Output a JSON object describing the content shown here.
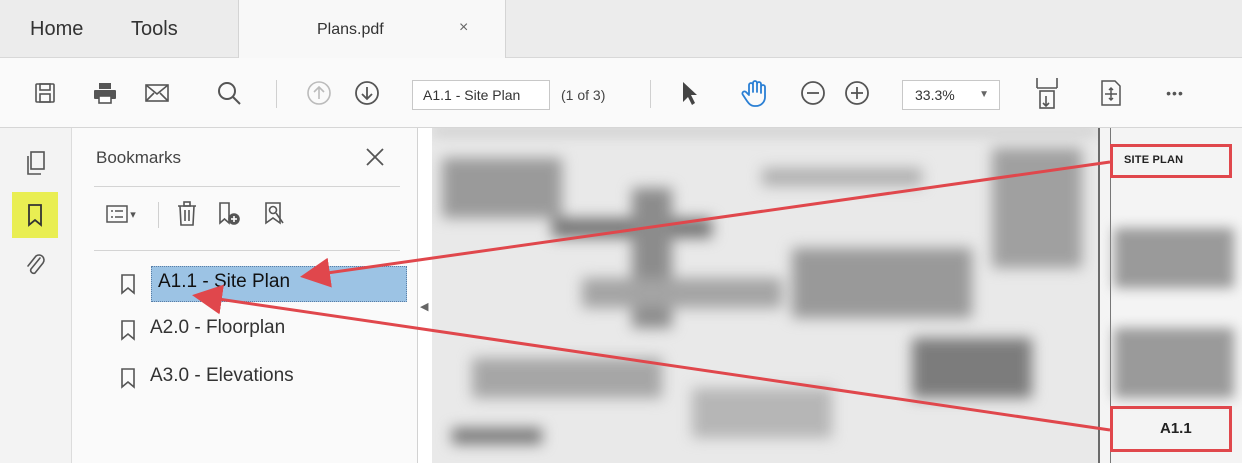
{
  "menubar": {
    "home_label": "Home",
    "tools_label": "Tools",
    "document_tab_title": "Plans.pdf",
    "document_tab_close": "×"
  },
  "toolbar": {
    "icons": [
      "save-icon",
      "print-icon",
      "email-icon",
      "search-icon",
      "previous-page-icon",
      "next-page-icon",
      "select-tool-icon",
      "hand-tool-icon",
      "zoom-out-icon",
      "zoom-in-icon",
      "fit-page-icon",
      "page-display-icon",
      "more-tools-icon"
    ],
    "page_box_value": "A1.1 - Site Plan",
    "page_count": "(1 of 3)",
    "zoom_value": "33.3%",
    "zoom_caret": "▼",
    "more_label": "•••"
  },
  "rail": {
    "icons": [
      "page-thumbnails-icon",
      "bookmarks-icon",
      "attachments-icon"
    ],
    "active_color": "#e9ee52"
  },
  "bookmarks_panel": {
    "title": "Bookmarks",
    "tools": [
      "options-icon",
      "delete-bookmark-icon",
      "new-bookmark-icon",
      "bookmark-search-icon"
    ],
    "options_caret": "▾",
    "items": [
      {
        "label": "A1.1 - Site Plan",
        "selected": true
      },
      {
        "label": "A2.0 - Floorplan",
        "selected": false
      },
      {
        "label": "A3.0 - Elevations",
        "selected": false
      }
    ],
    "selection_color": "#9cc3e4",
    "collapse_arrow": "◀"
  },
  "document": {
    "title_block_heading": "SITE PLAN",
    "sheet_number": "A1.1",
    "annotation_color": "#e0474c"
  }
}
